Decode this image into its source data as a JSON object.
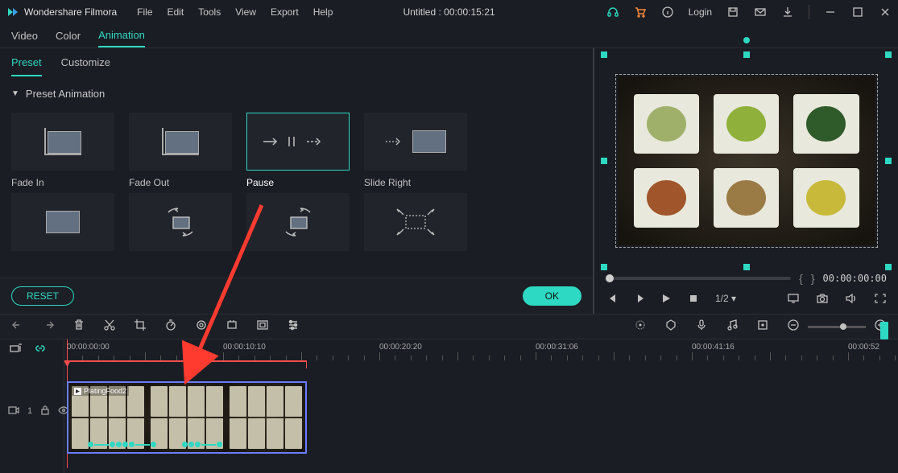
{
  "titlebar": {
    "app_name": "Wondershare Filmora",
    "menus": [
      "File",
      "Edit",
      "Tools",
      "View",
      "Export",
      "Help"
    ],
    "project_title": "Untitled : 00:00:15:21",
    "login": "Login"
  },
  "subnav": {
    "video": "Video",
    "color": "Color",
    "animation": "Animation"
  },
  "panel_tabs": {
    "preset": "Preset",
    "customize": "Customize"
  },
  "section": {
    "title": "Preset Animation"
  },
  "presets": [
    "Fade In",
    "Fade Out",
    "Pause",
    "Slide Right"
  ],
  "buttons": {
    "reset": "RESET",
    "ok": "OK"
  },
  "preview": {
    "timecode": "00:00:00:00",
    "fraction": "1/2"
  },
  "ruler": [
    "00:00:00:00",
    "00:00:10:10",
    "00:00:20:20",
    "00:00:31:06",
    "00:00:41:16",
    "00:00:52"
  ],
  "clip": {
    "name": "PlatingFood2"
  },
  "track": {
    "label": "1"
  }
}
